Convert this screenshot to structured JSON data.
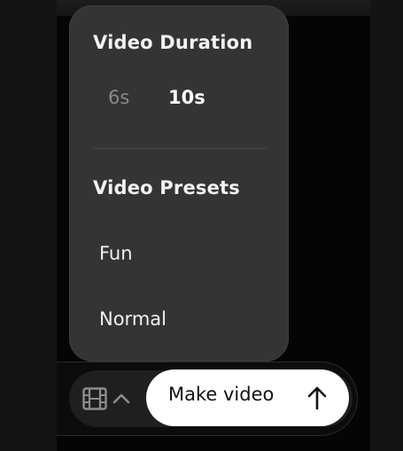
{
  "popover": {
    "duration": {
      "title": "Video Duration",
      "options": [
        {
          "label": "6s",
          "selected": false
        },
        {
          "label": "10s",
          "selected": true
        }
      ]
    },
    "presets": {
      "title": "Video Presets",
      "items": [
        {
          "label": "Fun"
        },
        {
          "label": "Normal"
        }
      ]
    }
  },
  "toolbar": {
    "media_icon": "film-icon",
    "expand_icon": "chevron-up-icon",
    "make_button_label": "Make video",
    "make_button_icon": "arrow-up-icon"
  },
  "colors": {
    "popover_bg": "#343434",
    "selected_text": "#ffffff",
    "unselected_text": "#8a8a8a",
    "primary_button": "#ffffff"
  }
}
